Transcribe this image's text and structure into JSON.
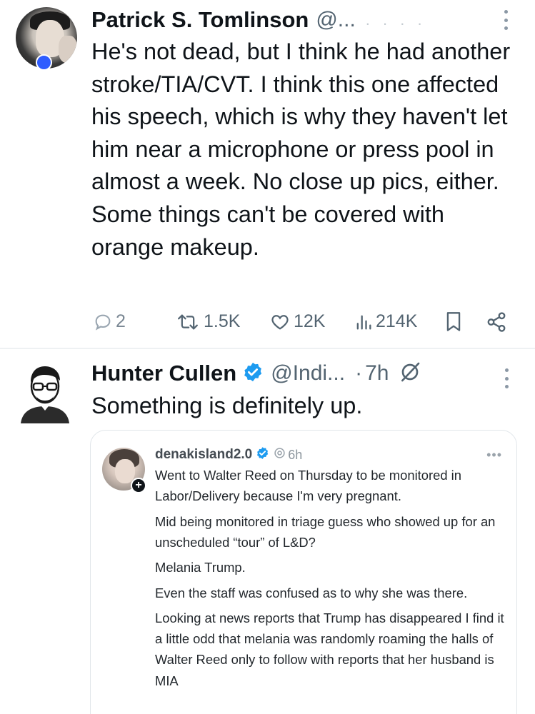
{
  "tweet1": {
    "author_name": "Patrick S. Tomlinson",
    "handle": "@...",
    "faint_ellipsis": ". . . .",
    "body": "He's not dead, but I think he had another stroke/TIA/CVT. I think this one affected his speech, which is why they haven't let him near a microphone or press pool in almost a week. No close up pics, either. Some things can't be covered with orange makeup.",
    "actions": {
      "replies": "2",
      "reposts": "1.5K",
      "likes": "12K",
      "views": "214K"
    },
    "icons": [
      "reply-icon",
      "retweet-icon",
      "like-icon",
      "views-icon",
      "bookmark-icon",
      "share-icon",
      "more-icon"
    ],
    "presence_color": "#2f5dff"
  },
  "tweet2": {
    "author_name": "Hunter Cullen",
    "handle": "@Indi...",
    "separator": "·",
    "time": "7h",
    "body": "Something is definitely up.",
    "verified_color": "#1d9bf0",
    "quoted": {
      "author_name": "denakisland2.0",
      "time": "6h",
      "more": "•••",
      "paragraphs": [
        "Went to Walter Reed on Thursday to be monitored in Labor/Delivery because I'm very pregnant.",
        "Mid being monitored in triage guess who showed up for an unscheduled “tour” of L&D?",
        "Melania Trump.",
        "Even the staff was confused as to why she was there.",
        "Looking at news reports that Trump has disappeared I find it a little odd that melania was randomly roaming the halls of Walter Reed only to follow with reports that her husband is MIA"
      ]
    }
  }
}
